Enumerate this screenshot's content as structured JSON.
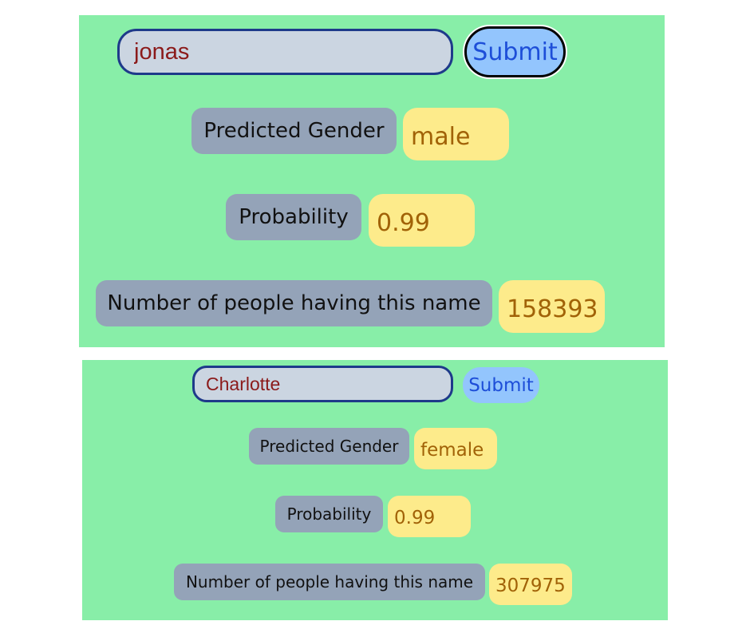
{
  "panels": [
    {
      "input_value": "jonas",
      "submit_label": "Submit",
      "gender_label": "Predicted Gender",
      "gender_value": "male",
      "probability_label": "Probability",
      "probability_value": "0.99",
      "count_label": "Number of people having this name",
      "count_value": "158393"
    },
    {
      "input_value": "Charlotte",
      "submit_label": "Submit",
      "gender_label": "Predicted Gender",
      "gender_value": "female",
      "probability_label": "Probability",
      "probability_value": "0.99",
      "count_label": "Number of people having this name",
      "count_value": "307975"
    }
  ],
  "colors": {
    "panel_bg": "#88eea8",
    "input_bg": "#cbd5e1",
    "input_border": "#1e3a8a",
    "input_text": "#8b1a1a",
    "button_bg": "#93c5fd",
    "button_text": "#1d4ed8",
    "label_bg": "#94a3b8",
    "value_bg": "#fdeb8b",
    "value_text": "#a16207"
  }
}
